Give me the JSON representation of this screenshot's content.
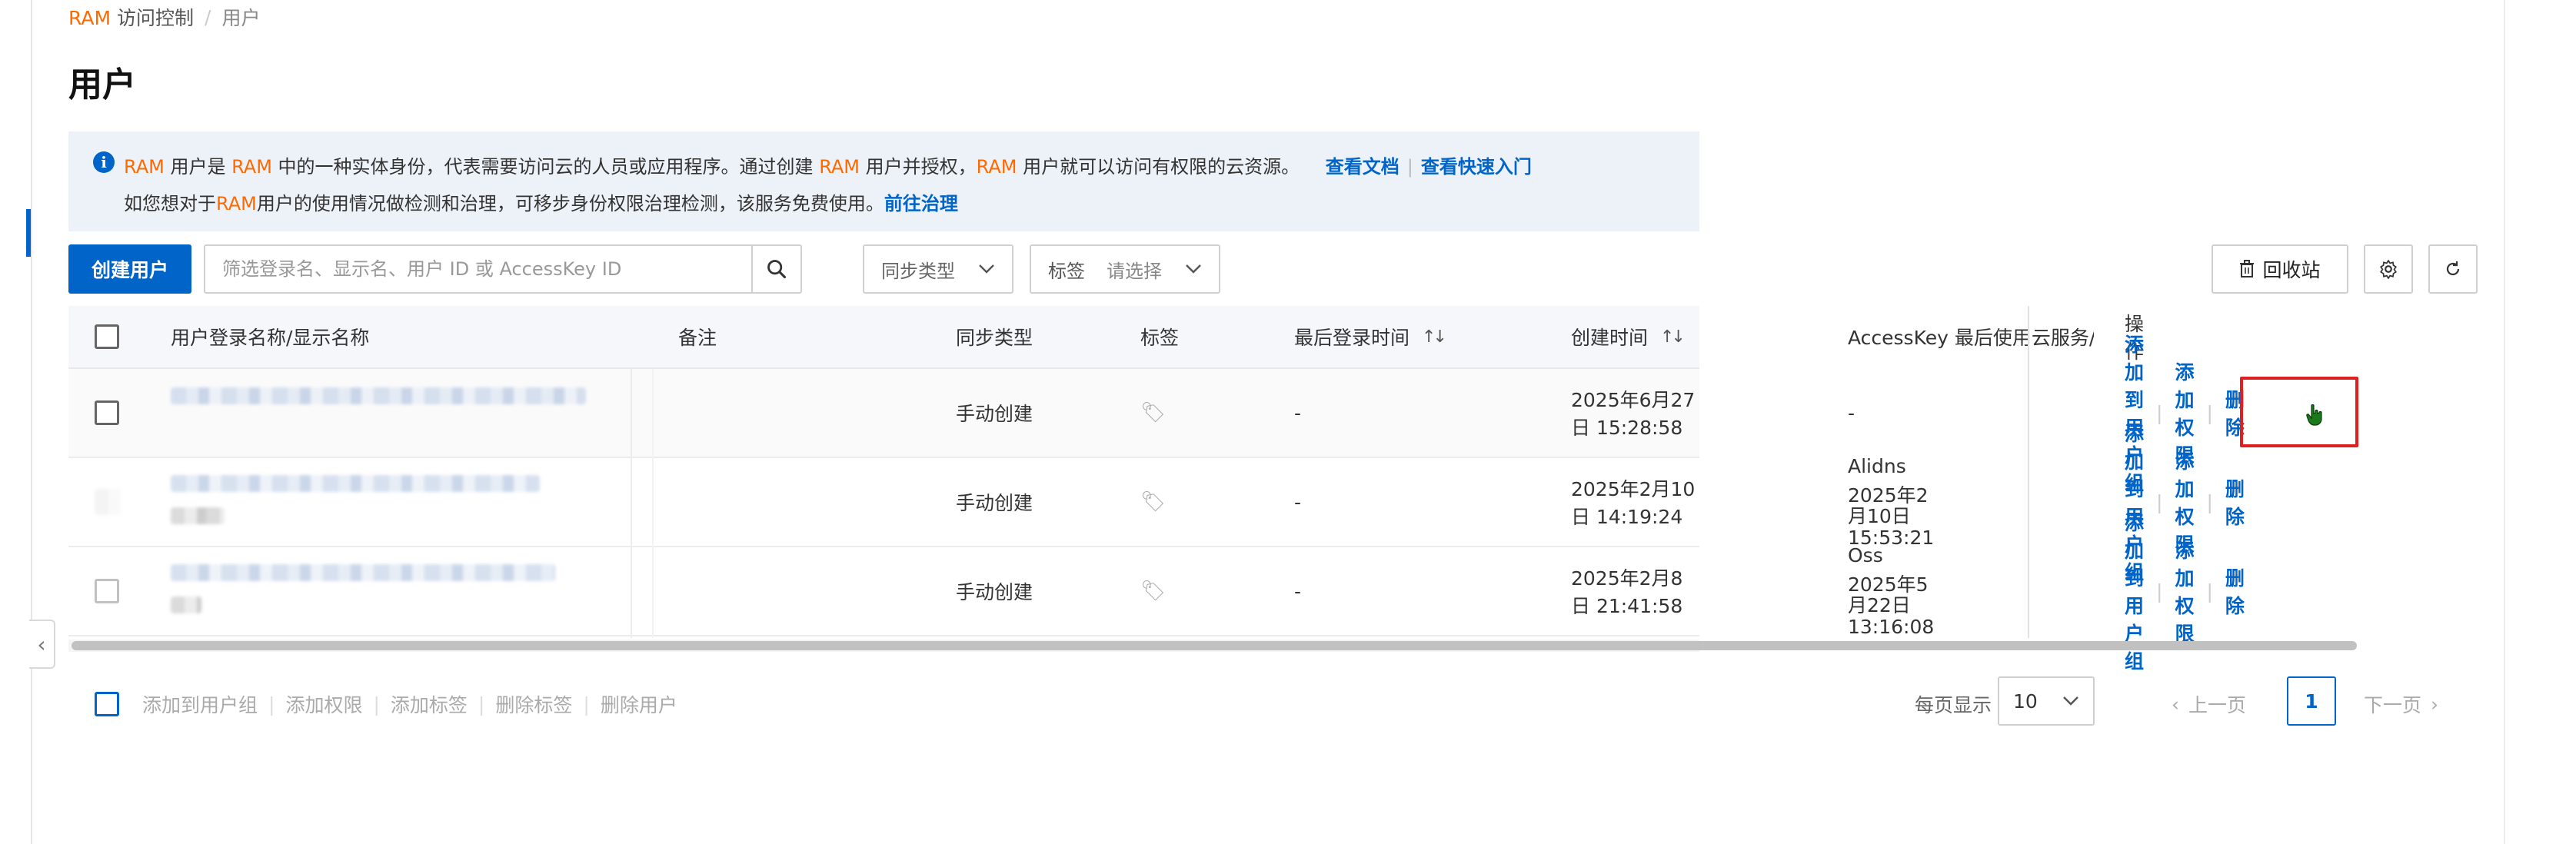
{
  "breadcrumb": {
    "ram": "RAM",
    "section": "访问控制",
    "separator": "/",
    "current": "用户"
  },
  "page_title": "用户",
  "notice": {
    "p1": "RAM",
    "p2": " 用户是 ",
    "p3": "RAM",
    "p4": " 中的一种实体身份，代表需要访问云的人员或应用程序。通过创建 ",
    "p5": "RAM",
    "p6": " 用户并授权，",
    "p7": "RAM",
    "p8": " 用户就可以访问有权限的云资源。",
    "link_docs": "查看文档",
    "link_quickstart": "查看快速入门",
    "q1": "如您想对于",
    "q2": "RAM",
    "q3": "用户的使用情况做检测和治理，可移步身份权限治理检测，该服务免费使用。",
    "link_governance": "前往治理"
  },
  "toolbar": {
    "create_user": "创建用户",
    "search_placeholder": "筛选登录名、显示名、用户 ID 或 AccessKey ID",
    "sync_type": "同步类型",
    "tag_label": "标签",
    "tag_placeholder": "请选择",
    "recycle_bin": "回收站"
  },
  "table": {
    "headers": {
      "name": "用户登录名称/显示名称",
      "note": "备注",
      "sync": "同步类型",
      "tag": "标签",
      "last_login": "最后登录时间",
      "created": "创建时间",
      "accesskey": "AccessKey 最后使用云服务/时间",
      "ops": "操作"
    },
    "rows": [
      {
        "sync": "手动创建",
        "last_login": "-",
        "created": "2025年6月27日 15:28:58",
        "ak_service": "-",
        "ak_time": ""
      },
      {
        "sync": "手动创建",
        "last_login": "-",
        "created": "2025年2月10日 14:19:24",
        "ak_service": "Alidns",
        "ak_time": "2025年2月10日 15:53:21"
      },
      {
        "sync": "手动创建",
        "last_login": "-",
        "created": "2025年2月8日 21:41:58",
        "ak_service": "Oss",
        "ak_time": "2025年5月22日 13:16:08"
      }
    ],
    "ops": {
      "add_to_group": "添加到用户组",
      "add_permission": "添加权限",
      "delete": "删除"
    }
  },
  "footer": {
    "batch": [
      "添加到用户组",
      "添加权限",
      "添加标签",
      "删除标签",
      "删除用户"
    ],
    "per_page_label": "每页显示",
    "per_page": "10",
    "prev": "上一页",
    "current_page": "1",
    "next": "下一页"
  },
  "colors": {
    "primary": "#0064c8",
    "accent": "#ff6a00",
    "highlight": "#e02020"
  },
  "icons": [
    "info-icon",
    "search-icon",
    "chevron-down-icon",
    "trash-icon",
    "gear-icon",
    "refresh-icon",
    "tag-icon",
    "sort-icon",
    "chevron-left-icon",
    "chevron-right-icon",
    "cursor-icon"
  ]
}
